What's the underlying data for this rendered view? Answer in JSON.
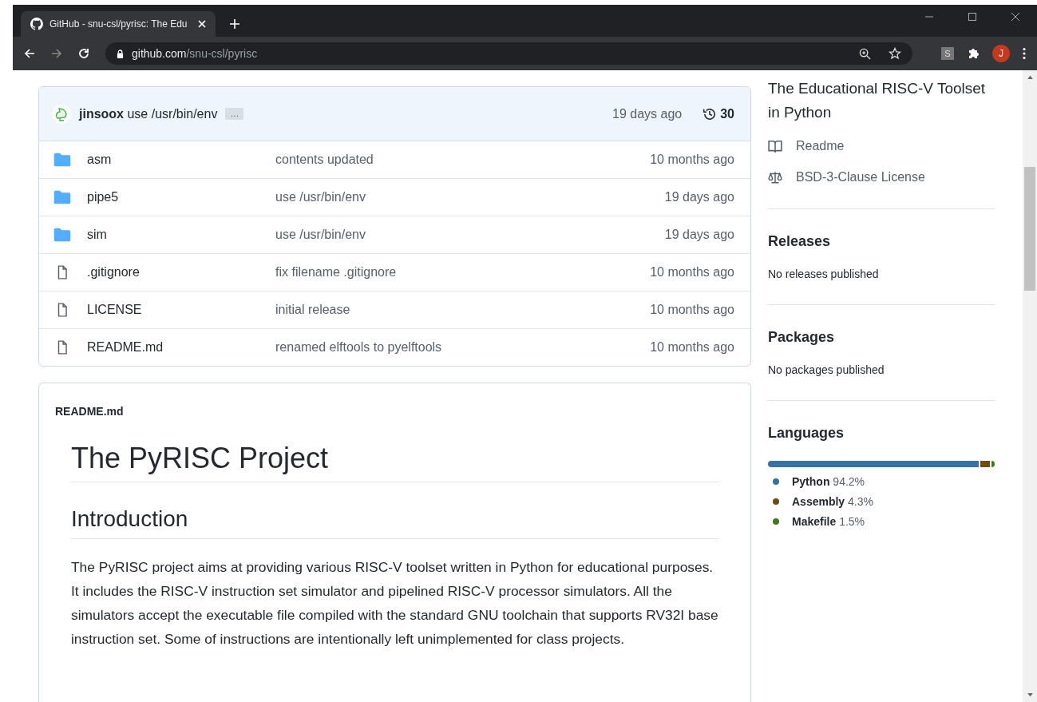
{
  "browser": {
    "tab_title": "GitHub - snu-csl/pyrisc: The Edu",
    "url_host": "github.com",
    "url_path": "/snu-csl/pyrisc",
    "profile_initial": "J",
    "extension_initial": "S"
  },
  "commit": {
    "author": "jinsoox",
    "message": "use /usr/bin/env",
    "ellipsis": "…",
    "time": "19 days ago",
    "count": "30"
  },
  "files": [
    {
      "kind": "folder",
      "name": "asm",
      "message": "contents updated",
      "time": "10 months ago"
    },
    {
      "kind": "folder",
      "name": "pipe5",
      "message": "use /usr/bin/env",
      "time": "19 days ago"
    },
    {
      "kind": "folder",
      "name": "sim",
      "message": "use /usr/bin/env",
      "time": "19 days ago"
    },
    {
      "kind": "file",
      "name": ".gitignore",
      "message": "fix filename .gitignore",
      "time": "10 months ago"
    },
    {
      "kind": "file",
      "name": "LICENSE",
      "message": "initial release",
      "time": "10 months ago"
    },
    {
      "kind": "file",
      "name": "README.md",
      "message": "renamed elftools to pyelftools",
      "time": "10 months ago"
    }
  ],
  "readme": {
    "filename": "README.md",
    "title": "The PyRISC Project",
    "heading": "Introduction",
    "paragraph": "The PyRISC project aims at providing various RISC-V toolset written in Python for educational purposes. It includes the RISC-V instruction set simulator and pipelined RISC-V processor simulators. All the simulators accept the executable file compiled with the standard GNU toolchain that supports RV32I base instruction set. Some of instructions are intentionally left unimplemented for class projects."
  },
  "sidebar": {
    "about": "The Educational RISC-V Toolset in Python",
    "links": [
      {
        "kind": "book",
        "label": "Readme"
      },
      {
        "kind": "scale",
        "label": "BSD-3-Clause License"
      }
    ],
    "sections": [
      {
        "title": "Releases",
        "note": "No releases published"
      },
      {
        "title": "Packages",
        "note": "No packages published"
      }
    ],
    "languages_title": "Languages",
    "languages": [
      {
        "name": "Python",
        "percent": "94.2%",
        "color": "#3572a5"
      },
      {
        "name": "Assembly",
        "percent": "4.3%",
        "color": "#6e4c13"
      },
      {
        "name": "Makefile",
        "percent": "1.5%",
        "color": "#427819"
      }
    ]
  }
}
